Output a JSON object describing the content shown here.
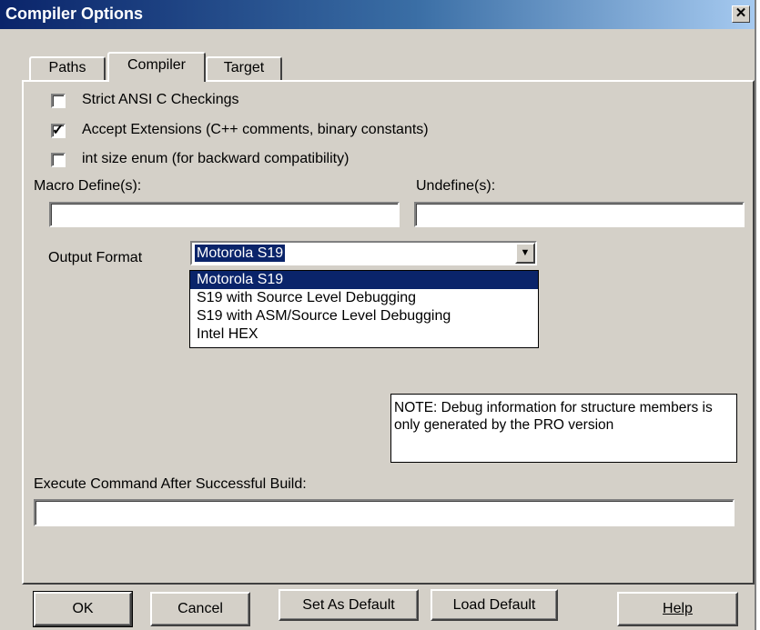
{
  "window": {
    "title": "Compiler Options",
    "close_glyph": "✕",
    "close_icon": "close-icon"
  },
  "tabs": [
    {
      "label": "Paths"
    },
    {
      "label": "Compiler",
      "active": true
    },
    {
      "label": "Target"
    }
  ],
  "options": {
    "strict_ansi": {
      "label": "Strict ANSI C Checkings",
      "checked": false
    },
    "accept_ext": {
      "label": "Accept Extensions (C++ comments, binary constants)",
      "checked": true
    },
    "int_enum": {
      "label": "int size enum (for backward compatibility)",
      "checked": false
    },
    "check_glyph": "✓"
  },
  "macro": {
    "define_label": "Macro Define(s):",
    "define_value": "",
    "undefine_label": "Undefine(s):",
    "undefine_value": ""
  },
  "output_format": {
    "label": "Output Format",
    "selected": "Motorola S19",
    "arrow_glyph": "▼",
    "options": [
      "Motorola S19",
      "S19 with Source Level Debugging",
      "S19 with ASM/Source Level Debugging",
      "Intel HEX"
    ]
  },
  "note": "NOTE: Debug information for structure members is only generated by the PRO version",
  "execute": {
    "label": "Execute Command After Successful Build:",
    "value": ""
  },
  "buttons": {
    "ok": "OK",
    "cancel": "Cancel",
    "set_default": "Set As Default",
    "load_default": "Load Default",
    "help": "Help"
  },
  "colors": {
    "title_active": "#0a246a",
    "dialog_bg": "#d4d0c8",
    "selection": "#0a246a"
  }
}
